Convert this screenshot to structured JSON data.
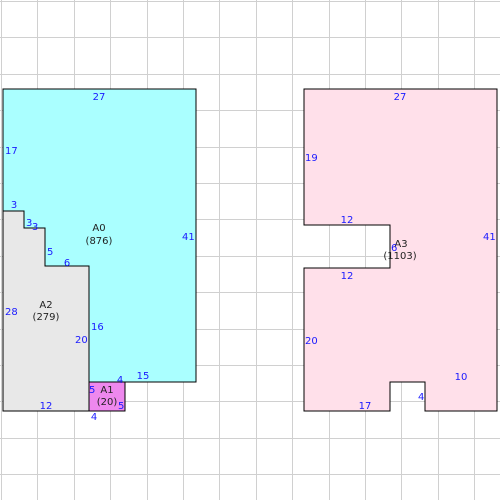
{
  "colors": {
    "grid": "#d0d0d0",
    "a0_fill": "#aaffff",
    "a1_fill": "#ee88ee",
    "a2_fill": "#e8e8e8",
    "a3_fill": "#ffe0ea",
    "outline": "#000000",
    "dimension_text": "#1a1aff",
    "label_text": "#222222"
  },
  "areas": {
    "a0": {
      "name": "A0",
      "area": "(876)"
    },
    "a1": {
      "name": "A1",
      "area": "(20)"
    },
    "a2": {
      "name": "A2",
      "area": "(279)"
    },
    "a3": {
      "name": "A3",
      "area": "(1103)"
    }
  },
  "dimensions": {
    "a0_top": "27",
    "a0_left": "17",
    "a0_right": "41",
    "a0_inner_vertical": "16",
    "a0_bottom": "15",
    "a2_step1": "3",
    "a2_step2": "3",
    "a2_step3": "3",
    "a2_step4": "5",
    "a2_step5": "6",
    "a2_left": "28",
    "a2_right": "20",
    "a2_bottom": "12",
    "a1_left": "5",
    "a1_top": "4",
    "a1_right": "5",
    "a1_bottom": "4",
    "a3_top": "27",
    "a3_left_upper": "19",
    "a3_notch_top": "12",
    "a3_notch_depth": "6",
    "a3_notch_bottom": "12",
    "a3_left_lower": "20",
    "a3_right": "41",
    "a3_bottom": "17",
    "a3_step": "4",
    "a3_bottom_right": "10"
  }
}
